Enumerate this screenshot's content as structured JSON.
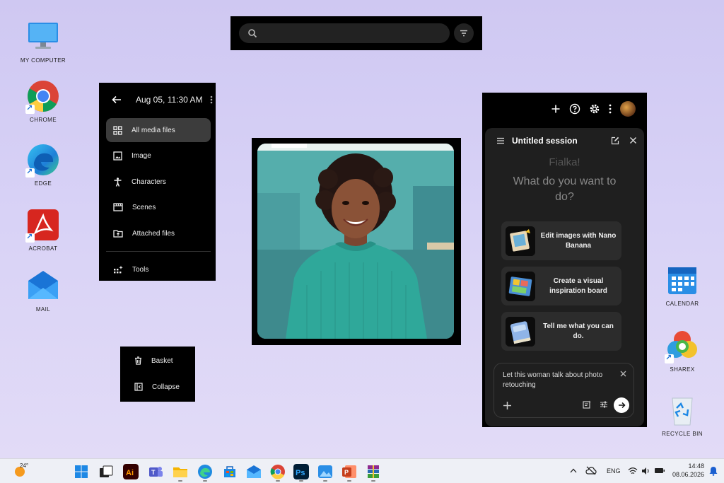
{
  "desktop": {
    "icons": [
      {
        "label": "MY COMPUTER",
        "icon": "monitor-icon"
      },
      {
        "label": "CHROME",
        "icon": "chrome-icon"
      },
      {
        "label": "EDGE",
        "icon": "edge-icon"
      },
      {
        "label": "ACROBAT",
        "icon": "acrobat-icon"
      },
      {
        "label": "MAIL",
        "icon": "mail-icon"
      },
      {
        "label": "CALENDAR",
        "icon": "calendar-icon"
      },
      {
        "label": "SHAREX",
        "icon": "sharex-icon"
      },
      {
        "label": "RECYCLE BIN",
        "icon": "recycle-bin-icon"
      }
    ]
  },
  "search": {
    "value": "",
    "placeholder": ""
  },
  "menu": {
    "date": "Aug 05, 11:30 AM",
    "items": [
      {
        "label": "All media files",
        "icon": "grid-icon",
        "active": true
      },
      {
        "label": "Image",
        "icon": "image-icon"
      },
      {
        "label": "Characters",
        "icon": "person-icon"
      },
      {
        "label": "Scenes",
        "icon": "film-icon"
      },
      {
        "label": "Attached files",
        "icon": "folder-upload-icon"
      },
      {
        "label": "Tools",
        "icon": "tools-icon"
      }
    ]
  },
  "small_menu": {
    "items": [
      {
        "label": "Basket",
        "icon": "trash-icon"
      },
      {
        "label": "Collapse",
        "icon": "collapse-icon"
      }
    ]
  },
  "assistant": {
    "session_title": "Untitled session",
    "greeting_name": "Fialka!",
    "greeting_question": "What do you want to do?",
    "suggestions": [
      {
        "label": "Edit images with Nano Banana"
      },
      {
        "label": "Create a visual inspiration board"
      },
      {
        "label": "Tell me what you can do."
      }
    ],
    "compose_text": "Let this woman talk about photo retouching"
  },
  "taskbar": {
    "temperature": "24°",
    "language": "ENG",
    "time": "14:48",
    "date": "08.06.2026",
    "apps": [
      "windows-start-icon",
      "task-view-icon",
      "illustrator-icon",
      "teams-icon",
      "file-explorer-icon",
      "edge-icon",
      "store-icon",
      "mail-icon",
      "chrome-icon",
      "photoshop-icon",
      "photos-icon",
      "powerpoint-icon",
      "winrar-icon"
    ]
  },
  "colors": {
    "panel_bg": "#000000",
    "session_bg": "#1f1f1f",
    "active_item": "#3c3c3c",
    "desktop_top": "#cfc8f2"
  }
}
